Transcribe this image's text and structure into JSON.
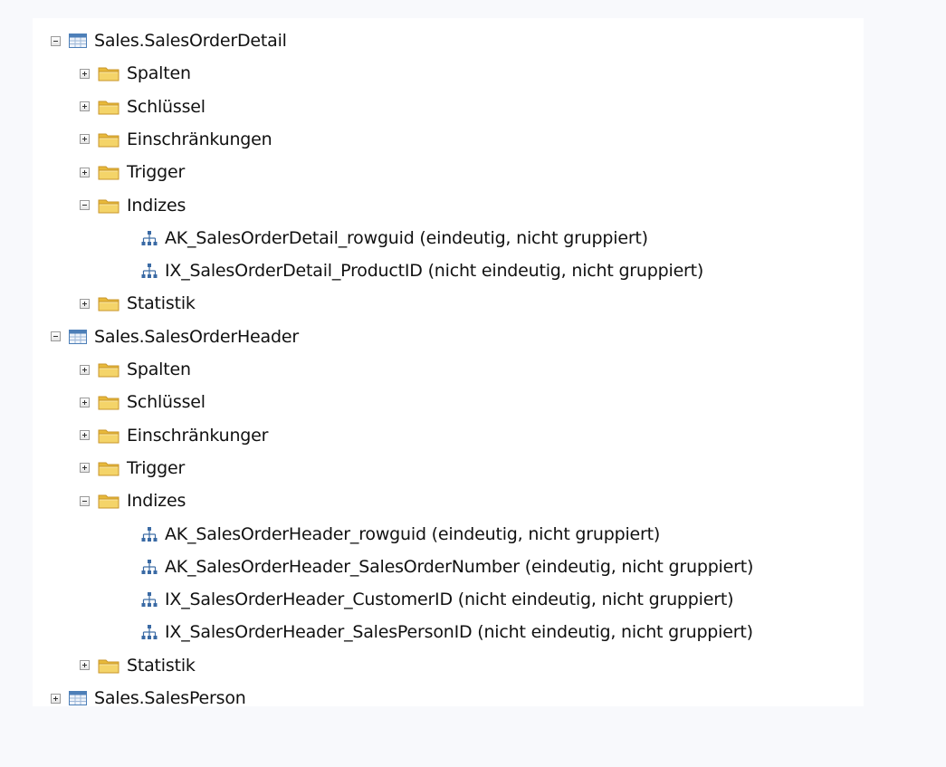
{
  "colors": {
    "folder_yellow": "#f4d469",
    "table_blue": "#4d7fb8",
    "index_blue": "#3a6aa4"
  },
  "tree": [
    {
      "label": "Sales.SalesOrderDetail",
      "icon": "table-icon",
      "expanded": true,
      "children": [
        {
          "label": "Spalten",
          "icon": "folder-icon",
          "expanded": false
        },
        {
          "label": "Schlüssel",
          "icon": "folder-icon",
          "expanded": false
        },
        {
          "label": "Einschränkungen",
          "icon": "folder-icon",
          "expanded": false
        },
        {
          "label": "Trigger",
          "icon": "folder-icon",
          "expanded": false
        },
        {
          "label": "Indizes",
          "icon": "folder-icon",
          "expanded": true,
          "children": [
            {
              "label": "AK_SalesOrderDetail_rowguid (eindeutig, nicht gruppiert)",
              "icon": "index-icon"
            },
            {
              "label": "IX_SalesOrderDetail_ProductID (nicht eindeutig, nicht gruppiert)",
              "icon": "index-icon"
            }
          ]
        },
        {
          "label": "Statistik",
          "icon": "folder-icon",
          "expanded": false
        }
      ]
    },
    {
      "label": "Sales.SalesOrderHeader",
      "icon": "table-icon",
      "expanded": true,
      "children": [
        {
          "label": "Spalten",
          "icon": "folder-icon",
          "expanded": false
        },
        {
          "label": "Schlüssel",
          "icon": "folder-icon",
          "expanded": false
        },
        {
          "label": "Einschränkunger",
          "icon": "folder-icon",
          "expanded": false
        },
        {
          "label": "Trigger",
          "icon": "folder-icon",
          "expanded": false
        },
        {
          "label": "Indizes",
          "icon": "folder-icon",
          "expanded": true,
          "children": [
            {
              "label": "AK_SalesOrderHeader_rowguid (eindeutig, nicht gruppiert)",
              "icon": "index-icon"
            },
            {
              "label": "AK_SalesOrderHeader_SalesOrderNumber (eindeutig, nicht gruppiert)",
              "icon": "index-icon"
            },
            {
              "label": "IX_SalesOrderHeader_CustomerID (nicht eindeutig, nicht gruppiert)",
              "icon": "index-icon"
            },
            {
              "label": "IX_SalesOrderHeader_SalesPersonID (nicht eindeutig, nicht gruppiert)",
              "icon": "index-icon"
            }
          ]
        },
        {
          "label": "Statistik",
          "icon": "folder-icon",
          "expanded": false
        }
      ]
    },
    {
      "label": "Sales.SalesPerson",
      "icon": "table-icon",
      "expanded": false
    }
  ]
}
